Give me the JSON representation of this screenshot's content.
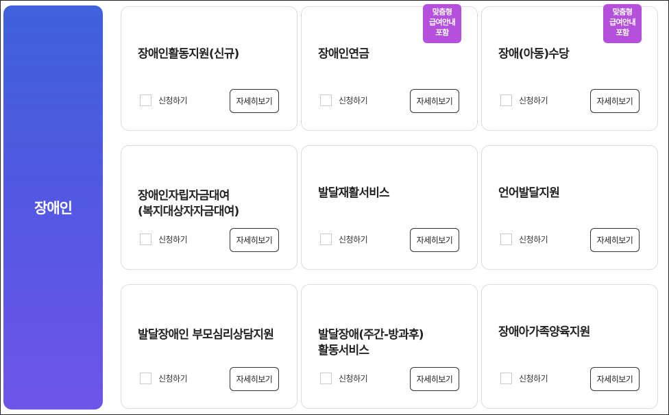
{
  "category": {
    "label": "장애인"
  },
  "badge_lines": [
    "맞춤형",
    "급여안내",
    "포함"
  ],
  "cards": [
    {
      "title": "장애인활동지원(신규)",
      "apply_label": "신청하기",
      "detail_label": "자세히보기"
    },
    {
      "title": "장애인연금",
      "apply_label": "신청하기",
      "detail_label": "자세히보기"
    },
    {
      "title": "장애(아동)수당",
      "apply_label": "신청하기",
      "detail_label": "자세히보기"
    },
    {
      "title": "장애인자립자금대여(복지대상자자금대여)",
      "apply_label": "신청하기",
      "detail_label": "자세히보기"
    },
    {
      "title": "발달재활서비스",
      "apply_label": "신청하기",
      "detail_label": "자세히보기"
    },
    {
      "title": "언어발달지원",
      "apply_label": "신청하기",
      "detail_label": "자세히보기"
    },
    {
      "title": "발달장애인 부모심리상담지원",
      "apply_label": "신청하기",
      "detail_label": "자세히보기"
    },
    {
      "title": "발달장애(주간-방과후)활동서비스",
      "apply_label": "신청하기",
      "detail_label": "자세히보기"
    },
    {
      "title": "장애아가족양육지원",
      "apply_label": "신청하기",
      "detail_label": "자세히보기"
    }
  ],
  "colors": {
    "category_gradient_top": "#3f62db",
    "category_gradient_bottom": "#6e55e9",
    "badge": "#b450dc"
  }
}
